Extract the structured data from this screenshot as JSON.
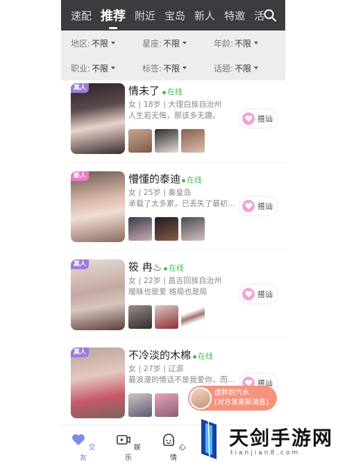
{
  "tabs": [
    {
      "label": "速配"
    },
    {
      "label": "推荐",
      "active": true
    },
    {
      "label": "附近"
    },
    {
      "label": "宝岛"
    },
    {
      "label": "新人"
    },
    {
      "label": "特邀"
    },
    {
      "label": "活"
    }
  ],
  "search_icon": "search-icon",
  "filters": {
    "row1": [
      {
        "label": "地区:",
        "value": "不限"
      },
      {
        "label": "星座:",
        "value": "不限"
      },
      {
        "label": "年龄:",
        "value": "不限"
      }
    ],
    "row2": [
      {
        "label": "职业:",
        "value": "不限"
      },
      {
        "label": "标签:",
        "value": "不限"
      },
      {
        "label": "话题:",
        "value": "不限"
      }
    ]
  },
  "users": [
    {
      "badge": "真人",
      "name": "情未了",
      "online": "在线",
      "meta": "女 | 18岁 | 大理白族自治州",
      "bio": "人生若无悔，那该多无趣。",
      "action": "搭讪"
    },
    {
      "badge": "新人",
      "name": "懵懂的泰迪",
      "online": "在线",
      "meta": "女 | 25岁 | 秦皇岛",
      "bio": "承载了太多累，已丢失了最初...",
      "action": "搭讪"
    },
    {
      "badge": "真人",
      "name": "筱  冉♨",
      "online": "在线",
      "meta": "女 | 22岁 | 昌吉回族自治州",
      "bio": "暧昧也是爱  格局也是局",
      "action": "搭讪"
    },
    {
      "badge": "真人",
      "name": "不冷淡的木棉",
      "online": "在线",
      "meta": "女 | 27岁 | 辽源",
      "bio": "最浪漫的情话不是我爱你，而...",
      "action": "搭讪"
    }
  ],
  "toast": {
    "name": "虚胖的汽水",
    "message": "[对方发来新消息]"
  },
  "nav": [
    {
      "label": "交友",
      "icon": "heart-chat-icon",
      "active": true
    },
    {
      "label": "娱乐",
      "icon": "video-play-icon"
    },
    {
      "label": "心情",
      "icon": "mood-face-icon"
    }
  ],
  "watermark": {
    "title": "天剑手游网",
    "url": "tianjian8.com"
  },
  "colors": {
    "topbar": "#3d3a40",
    "online": "#4cb85a",
    "accent": "#6d7de8",
    "toast": "#f4937f"
  }
}
